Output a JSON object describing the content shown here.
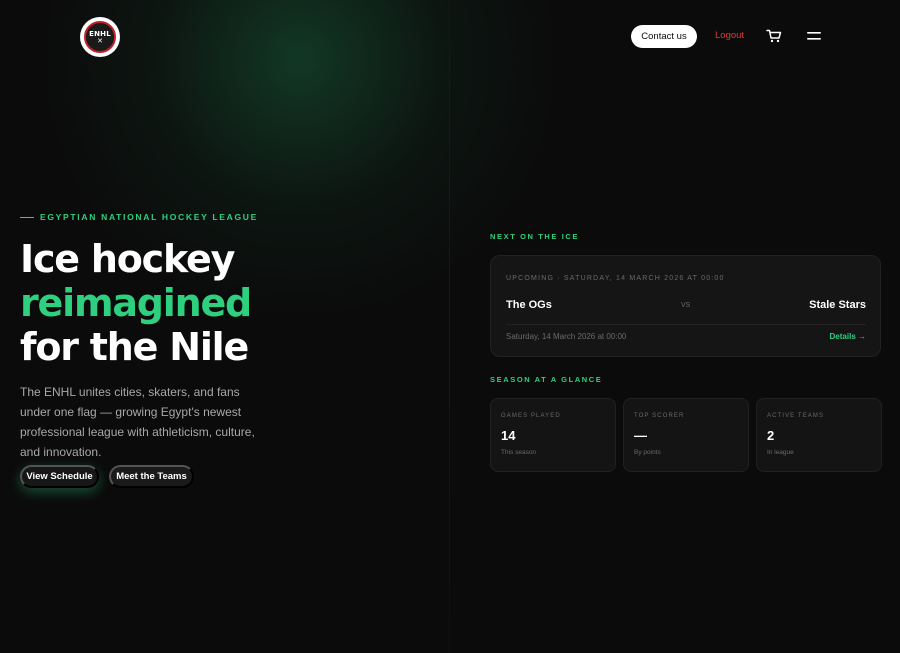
{
  "header": {
    "logo_text": "ENHL",
    "contact_label": "Contact us",
    "logout_label": "Logout",
    "cart_icon": "cart-icon",
    "menu_icon": "hamburger-menu-icon"
  },
  "hero": {
    "eyebrow": "EGYPTIAN NATIONAL HOCKEY LEAGUE",
    "title_line1": "Ice hockey",
    "title_line2": "reimagined",
    "title_line3": "for the Nile",
    "description": "The ENHL unites cities, skaters, and fans under one flag — growing Egypt's newest professional league with athleticism, culture, and innovation.",
    "primary_button": "View Schedule",
    "secondary_button": "Meet the Teams"
  },
  "next_game": {
    "section_label": "NEXT ON THE ICE",
    "meta": "UPCOMING · SATURDAY, 14 MARCH 2026 AT 00:00",
    "home_team": "The OGs",
    "vs_label": "VS",
    "away_team": "Stale Stars",
    "date": "Saturday, 14 March 2026 at 00:00",
    "details_label": "Details →"
  },
  "season": {
    "section_label": "SEASON AT A GLANCE",
    "stats": [
      {
        "label": "GAMES PLAYED",
        "value": "14",
        "sub": "This season"
      },
      {
        "label": "TOP SCORER",
        "value": "—",
        "sub": "By points"
      },
      {
        "label": "ACTIVE TEAMS",
        "value": "2",
        "sub": "In league"
      }
    ]
  },
  "colors": {
    "background": "#0b0b0b",
    "accent": "#2fcf80",
    "logout": "#e03a3a",
    "card": "#151515"
  }
}
